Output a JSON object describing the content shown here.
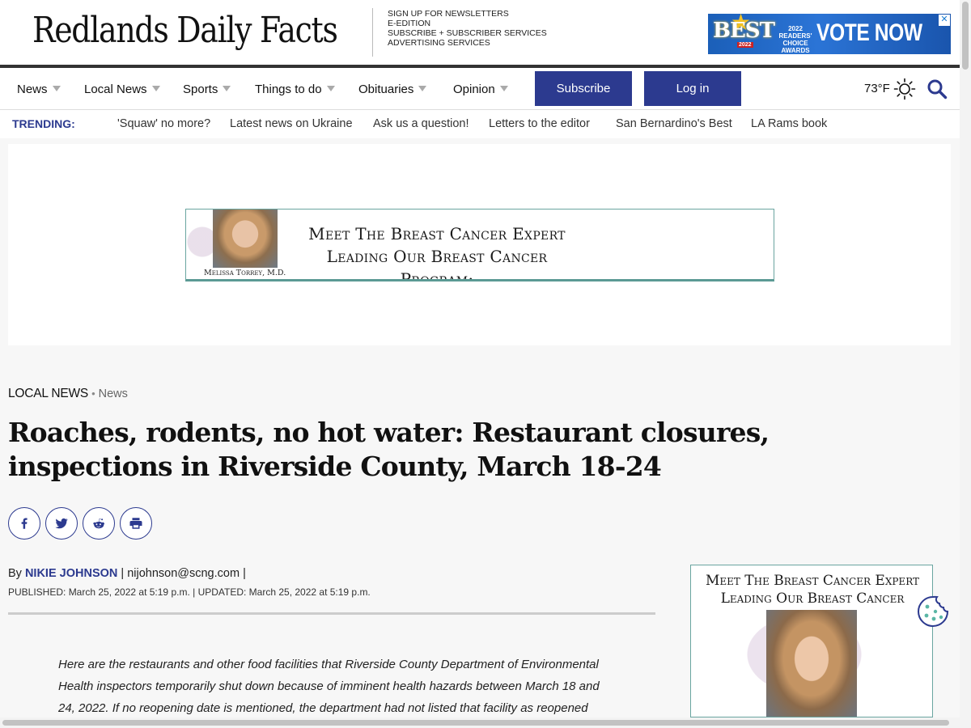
{
  "masthead": {
    "logo": "Redlands Daily Facts",
    "links": [
      "SIGN UP FOR NEWSLETTERS",
      "E-EDITION",
      "SUBSCRIBE + SUBSCRIBER SERVICES",
      "ADVERTISING SERVICES"
    ],
    "top_ad": {
      "best": "BEST",
      "year": "2022",
      "readers_choice": "2022 READERS' CHOICE AWARDS",
      "cta": "VOTE NOW",
      "close": "✕"
    }
  },
  "nav": {
    "items": [
      "News",
      "Local News",
      "Sports",
      "Things to do",
      "Obituaries",
      "Opinion"
    ],
    "subscribe": "Subscribe",
    "login": "Log in",
    "weather": "73°F"
  },
  "trending": {
    "label": "TRENDING:",
    "items": [
      "'Squaw' no more?",
      "Latest news on Ukraine",
      "Ask us a question!",
      "Letters to the editor",
      "San Bernardino's Best",
      "LA Rams book"
    ]
  },
  "banner_ad": {
    "line1": "Meet The Breast Cancer Expert",
    "line2": "Leading Our Breast Cancer Program:",
    "caption": "Melissa Torrey, M.D."
  },
  "article": {
    "section": "LOCAL NEWS",
    "subsection": "News",
    "headline": "Roaches, rodents, no hot water: Restaurant closures, inspections in Riverside County, March 18-24",
    "byline_prefix": "By ",
    "author": "NIKIE JOHNSON",
    "email": " | nijohnson@scng.com |",
    "dates": "PUBLISHED: March 25, 2022 at 5:19 p.m. | UPDATED: March 25, 2022 at 5:19 p.m.",
    "intro": "Here are the restaurants and other food facilities that Riverside County Department of Environmental Health inspectors temporarily shut down because of imminent health hazards between March 18 and 24, 2022. If no reopening date is mentioned, the department had not listed that facility as reopened as"
  },
  "side_ad": {
    "line1": "Meet The Breast Cancer Expert",
    "line2": "Leading Our Breast Cancer Program:"
  },
  "colors": {
    "brand_blue": "#2c3a8f",
    "page_bg": "#f7f7f7"
  },
  "icons": [
    "caret-down-icon",
    "sun-icon",
    "search-icon",
    "facebook-icon",
    "twitter-icon",
    "reddit-icon",
    "print-icon",
    "cookie-icon"
  ]
}
